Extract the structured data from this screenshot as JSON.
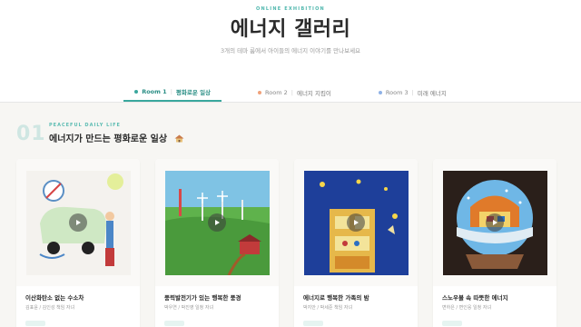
{
  "header": {
    "eyebrow": "ONLINE EXHIBITION",
    "title": "에너지 갤러리",
    "subtitle": "3개의 테마 룸에서 아이들의 에너지 이야기를 만나보세요"
  },
  "tabs": [
    {
      "room": "Room 1",
      "name": "평화로운 일상",
      "dot_color": "#3aa79d",
      "active": true
    },
    {
      "room": "Room 2",
      "name": "에너지 지킴이",
      "dot_color": "#f0a27a",
      "active": false
    },
    {
      "room": "Room 3",
      "name": "미래 에너지",
      "dot_color": "#8fb2e6",
      "active": false
    }
  ],
  "section": {
    "number": "01",
    "eyebrow": "PEACEFUL DAILY LIFE",
    "title": "에너지가 만드는 평화로운 일상",
    "icon": "house-icon"
  },
  "cards": [
    {
      "title": "이산화탄소 없는 수소차",
      "author": "김표윤 / 김인성 책임 자녀"
    },
    {
      "title": "풍력발전기가 있는 행복한 풍경",
      "author": "박우연 / 박진영 일청 자녀"
    },
    {
      "title": "에너지로 행복한 가족의 밤",
      "author": "박지안 / 박세준 책임 자녀"
    },
    {
      "title": "스노우볼 속 따뜻한 에너지",
      "author": "변하은 / 변인응 일청 자녀"
    }
  ],
  "colors": {
    "accent": "#3aa79d",
    "background": "#f7f6f3"
  }
}
